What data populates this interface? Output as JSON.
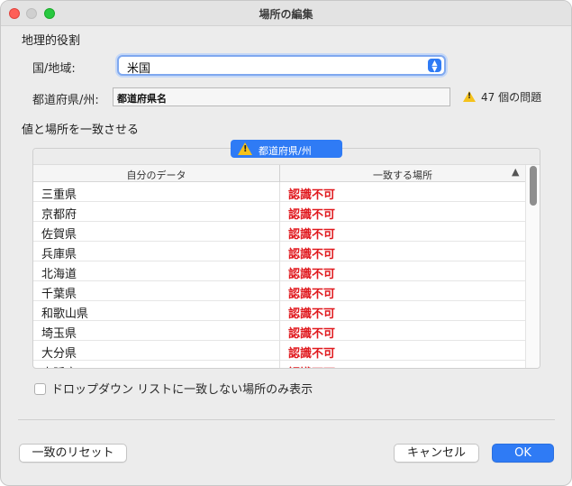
{
  "window": {
    "title": "場所の編集"
  },
  "geo_role": {
    "section_label": "地理的役割",
    "country_label": "国/地域:",
    "country_value": "米国",
    "state_label": "都道府県/州:",
    "state_value": "都道府県名",
    "issues_text": "47 個の問題"
  },
  "match": {
    "section_label": "値と場所を一致させる",
    "tab_label": "都道府県/州",
    "col_my_data": "自分のデータ",
    "col_matching_location": "一致する場所",
    "sort_icon": "▲",
    "rows": [
      {
        "data": "三重県",
        "match": "認識不可"
      },
      {
        "data": "京都府",
        "match": "認識不可"
      },
      {
        "data": "佐賀県",
        "match": "認識不可"
      },
      {
        "data": "兵庫県",
        "match": "認識不可"
      },
      {
        "data": "北海道",
        "match": "認識不可"
      },
      {
        "data": "千葉県",
        "match": "認識不可"
      },
      {
        "data": "和歌山県",
        "match": "認識不可"
      },
      {
        "data": "埼玉県",
        "match": "認識不可"
      },
      {
        "data": "大分県",
        "match": "認識不可"
      },
      {
        "data": "大阪府",
        "match": "認識不可"
      }
    ]
  },
  "filter": {
    "checkbox_label": "ドロップダウン リストに一致しない場所のみ表示",
    "checked": false
  },
  "buttons": {
    "reset": "一致のリセット",
    "cancel": "キャンセル",
    "ok": "OK"
  },
  "colors": {
    "accent": "#2f7bf5",
    "error": "#e0191e",
    "warning": "#f5c21b"
  }
}
